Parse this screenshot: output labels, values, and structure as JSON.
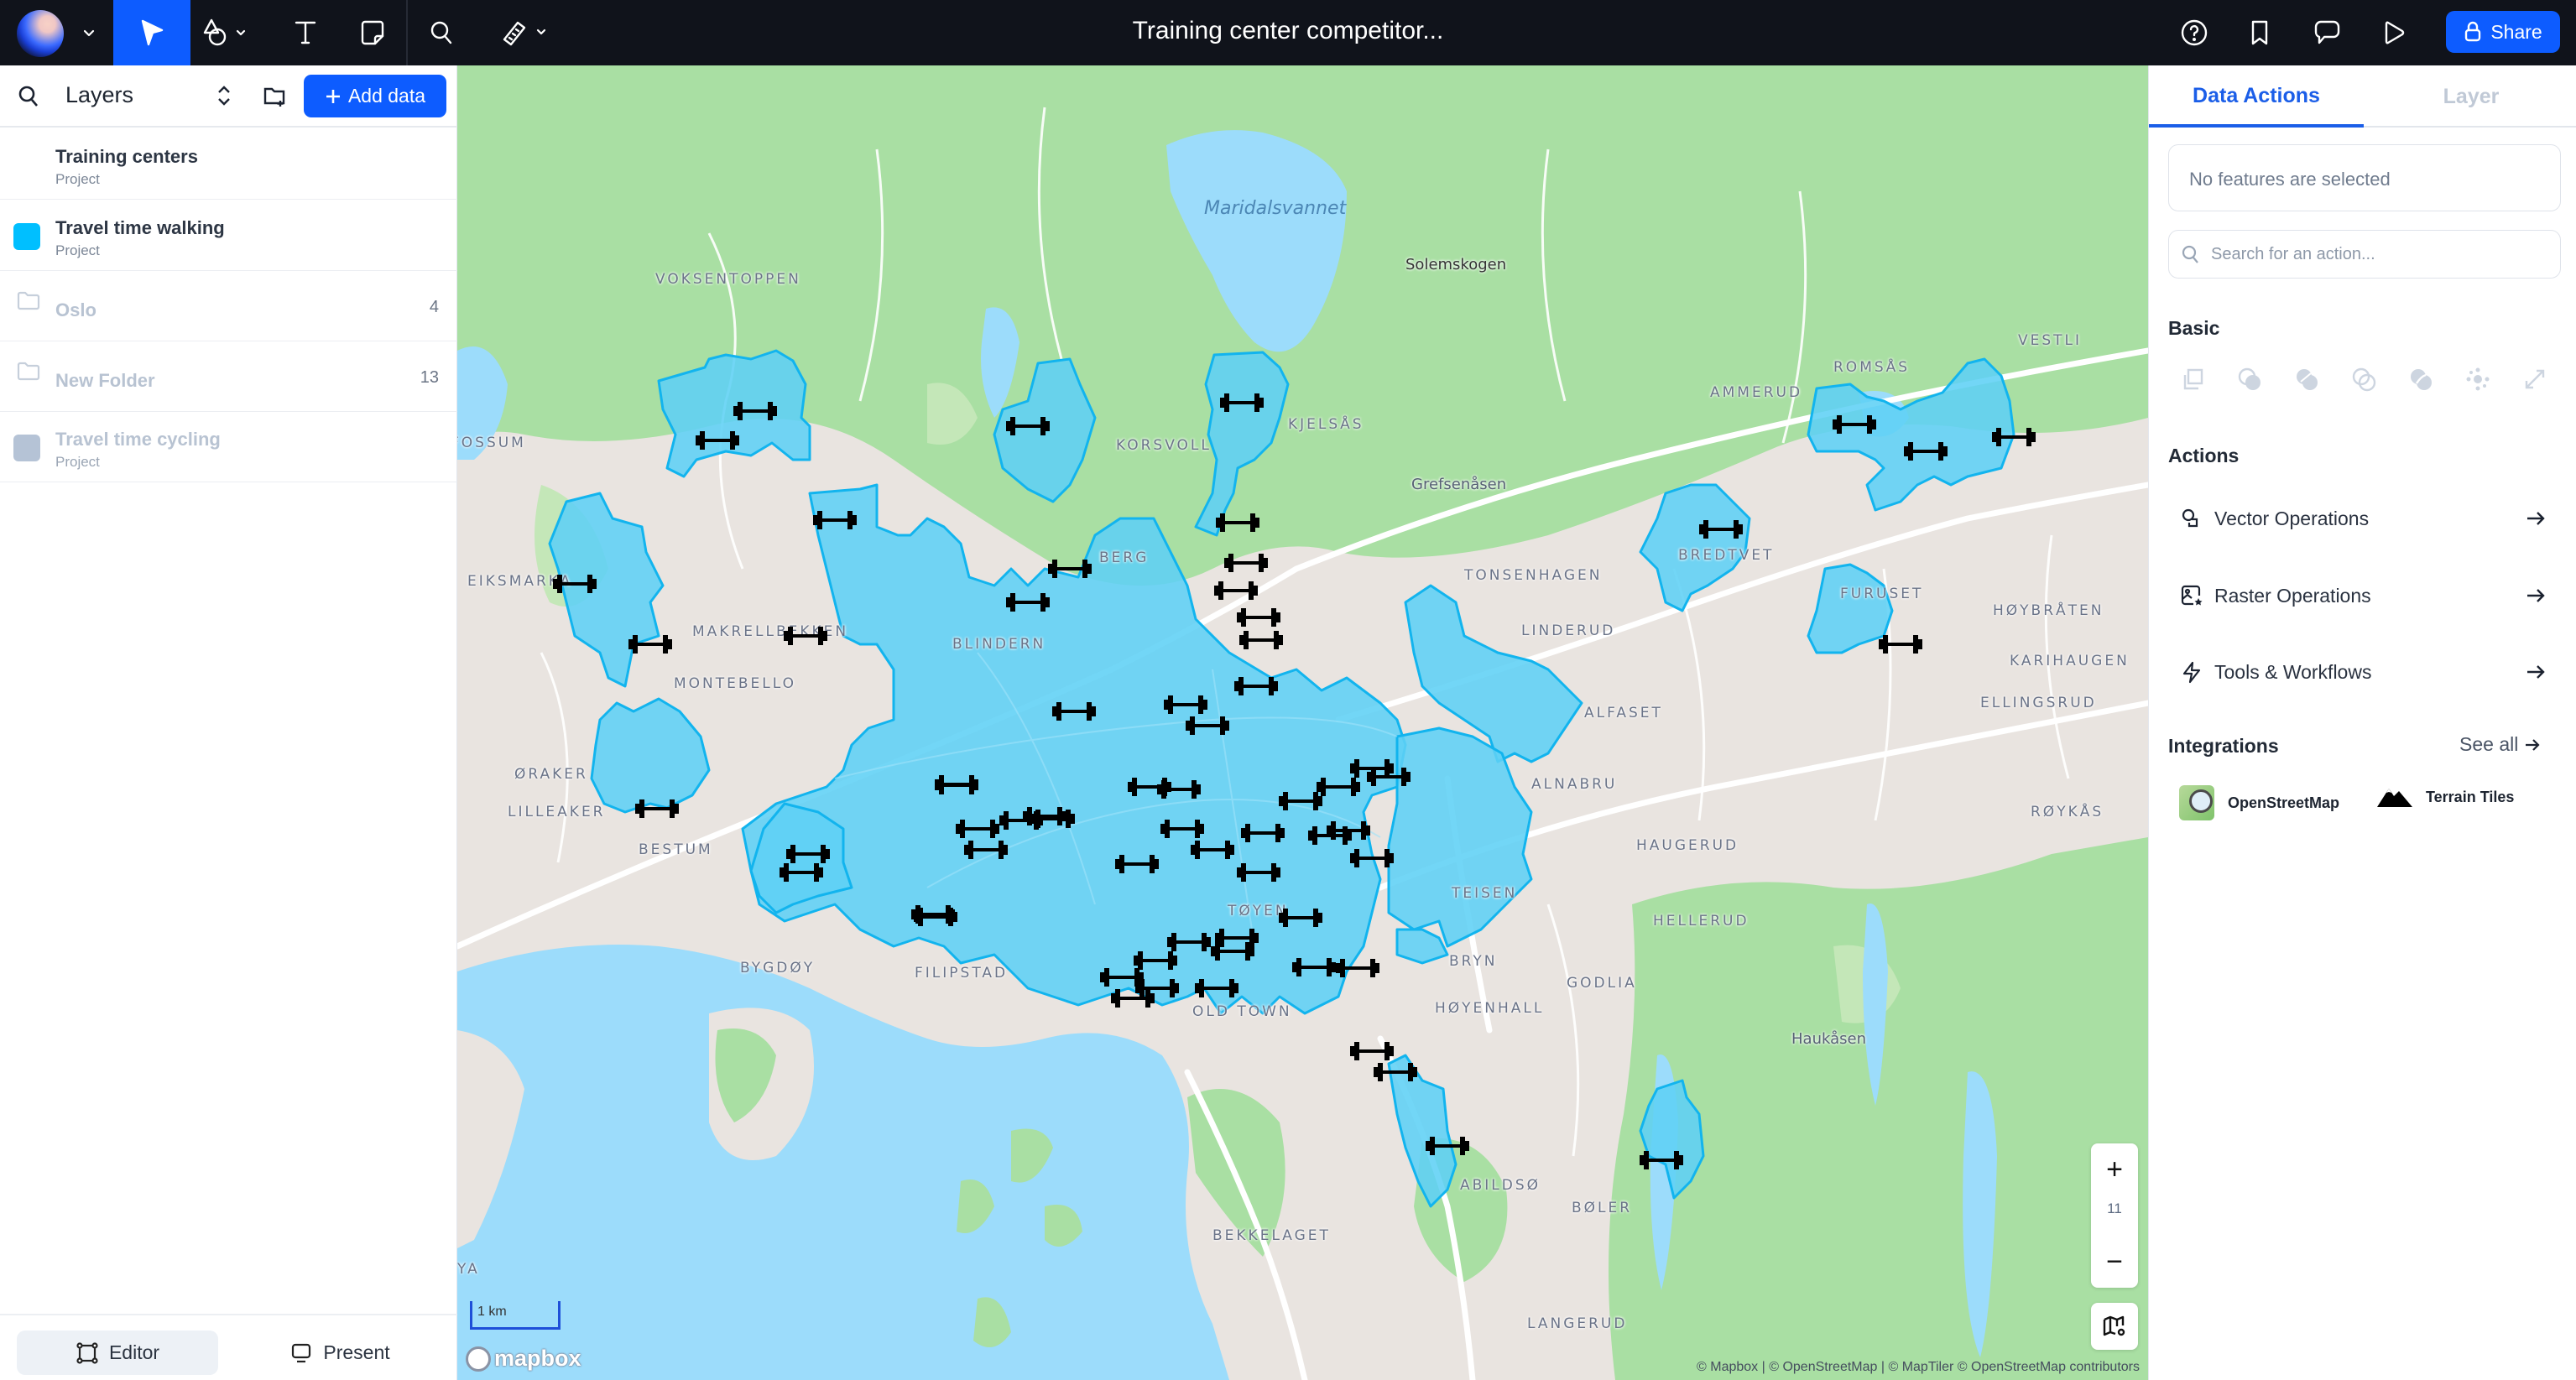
{
  "topbar": {
    "title": "Training center competitor...",
    "tools": [
      "logo-menu",
      "select-tool",
      "shape-tool",
      "text-tool",
      "note-tool",
      "search-tool",
      "measure-tool"
    ],
    "right_icons": [
      "help-icon",
      "bookmark-icon",
      "comment-icon",
      "play-icon"
    ],
    "share_label": "Share"
  },
  "sidebar": {
    "title": "Layers",
    "add_data_label": "Add data",
    "layers": [
      {
        "name": "Training centers",
        "sub": "Project",
        "swatch": null,
        "dim": false
      },
      {
        "name": "Travel time walking",
        "sub": "Project",
        "swatch": "#00bfff",
        "dim": false
      },
      {
        "name": "Oslo",
        "type": "folder",
        "count": "4",
        "dim": true
      },
      {
        "name": "New Folder",
        "type": "folder",
        "count": "13",
        "dim": true
      },
      {
        "name": "Travel time cycling",
        "sub": "Project",
        "swatch": "#b5c3d6",
        "dim": true
      }
    ],
    "footer": {
      "editor_label": "Editor",
      "present_label": "Present",
      "active": "Editor"
    }
  },
  "map": {
    "colors": {
      "isochrone_fill": "#5fd0f5",
      "isochrone_stroke": "#12b4ee",
      "water": "#9cdcfb",
      "forest": "#a7dea2",
      "urban": "#ebe5e1"
    },
    "labels": {
      "maridalsvannet": "Maridalsvannet",
      "solemskogen": "Solemskogen",
      "voksentoppen": "VOKSENTOPPEN",
      "fossum": "FOSSUM",
      "korsvoll": "KORSVOLL",
      "kjelsas": "KJELSÅS",
      "grefsenasen": "Grefsenåsen",
      "berg": "BERG",
      "eiksmarka": "EIKSMARKA",
      "makrellbekken": "MAKRELLBEKKEN",
      "blindern": "BLINDERN",
      "montebello": "MONTEBELLO",
      "oraker": "ØRAKER",
      "lilleaker": "LILLEAKER",
      "bestum": "BESTUM",
      "bygdoy": "BYGDØY",
      "filipstad": "FILIPSTAD",
      "toyen": "TØYEN",
      "old_town": "OLD TOWN",
      "tonsenhagen": "TONSENHAGEN",
      "linderud": "LINDERUD",
      "alfaset": "ALFASET",
      "alnabru": "ALNABRU",
      "teisen": "TEISEN",
      "bryn": "BRYN",
      "hoyenhall": "HØYENHALL",
      "godlia": "GODLIA",
      "haugerud": "HAUGERUD",
      "hellerud": "HELLERUD",
      "ammerud": "AMMERUD",
      "romsas": "ROMSÅS",
      "vestli": "VESTLI",
      "bredtvet": "BREDTVET",
      "furuset": "FURUSET",
      "hoybraten": "HØYBRÅTEN",
      "karihaugen": "KARIHAUGEN",
      "ellingsrud": "ELLINGSRUD",
      "roykas": "RØYKÅS",
      "haukasen": "Haukåsen",
      "abildso": "ABILDSØ",
      "boler": "BØLER",
      "bekkelaget": "BEKKELAGET",
      "langerud": "LANGERUD",
      "ya": "YA"
    },
    "gym_marker_count": 62,
    "zoom_level": "11",
    "scale_label": "1 km",
    "logo_text": "mapbox",
    "attribution": "© Mapbox | © OpenStreetMap | © MapTiler © OpenStreetMap contributors"
  },
  "rpanel": {
    "tabs": [
      "Data Actions",
      "Layer"
    ],
    "active_tab": "Data Actions",
    "no_selection": "No features are selected",
    "search_placeholder": "Search for an action...",
    "basic_title": "Basic",
    "basic_icons": [
      "duplicate-icon",
      "union-icon",
      "difference-icon",
      "intersect-icon",
      "symmetric-difference-icon",
      "explode-icon",
      "expand-icon"
    ],
    "actions_title": "Actions",
    "actions": [
      {
        "label": "Vector Operations",
        "icon": "vector-ops-icon"
      },
      {
        "label": "Raster Operations",
        "icon": "raster-ops-icon"
      },
      {
        "label": "Tools & Workflows",
        "icon": "lightning-icon"
      }
    ],
    "integrations_title": "Integrations",
    "see_all_label": "See all",
    "integrations": [
      {
        "label": "OpenStreetMap",
        "icon": "openstreetmap-icon"
      },
      {
        "label": "Terrain Tiles",
        "icon": "mountain-icon"
      }
    ]
  }
}
